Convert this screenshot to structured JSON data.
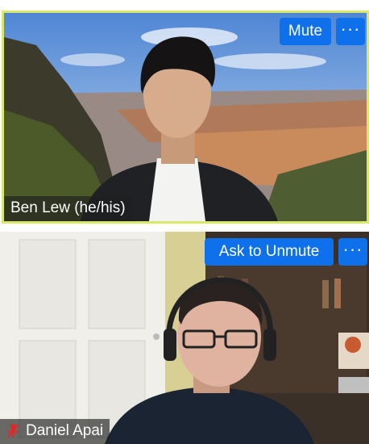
{
  "participants": [
    {
      "name": "Ben Lew (he/his)",
      "action_label": "Mute",
      "more_label": "···",
      "active_speaker": true,
      "muted": false,
      "background": "grand-canyon-virtual-background"
    },
    {
      "name": "Daniel Apai",
      "action_label": "Ask to Unmute",
      "more_label": "···",
      "active_speaker": false,
      "muted": true,
      "muted_icon": "muted-mic-icon",
      "background": "room-with-door-and-bookshelf"
    }
  ],
  "colors": {
    "button_blue": "#0e71eb",
    "active_speaker_border": "#d8e86a",
    "muted_icon_red": "#e02828"
  }
}
